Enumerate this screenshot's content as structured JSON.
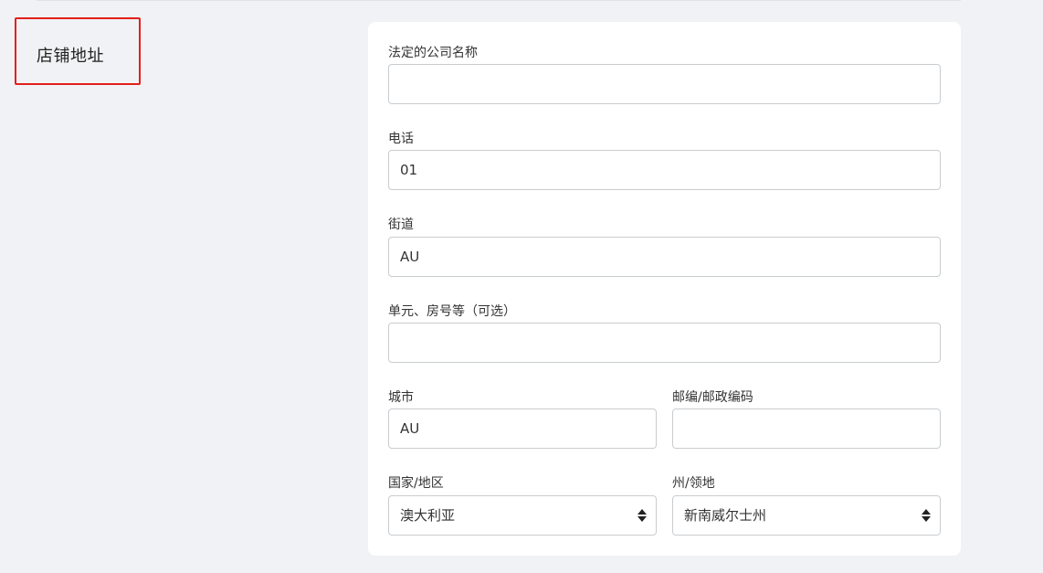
{
  "section": {
    "title": "店铺地址"
  },
  "form": {
    "company_name": {
      "label": "法定的公司名称",
      "value": ""
    },
    "phone": {
      "label": "电话",
      "value": "01"
    },
    "street": {
      "label": "街道",
      "value": "AU"
    },
    "unit": {
      "label": "单元、房号等（可选）",
      "value": ""
    },
    "city": {
      "label": "城市",
      "value": "AU"
    },
    "postal": {
      "label": "邮编/邮政编码",
      "value": ""
    },
    "country": {
      "label": "国家/地区",
      "value": "澳大利亚"
    },
    "state": {
      "label": "州/领地",
      "value": "新南威尔士州"
    }
  },
  "colors": {
    "highlight": "#e3201b",
    "background": "#f1f2f5",
    "card": "#ffffff",
    "border": "#c9cccf"
  },
  "icons": {
    "select": "select-arrows-icon"
  }
}
